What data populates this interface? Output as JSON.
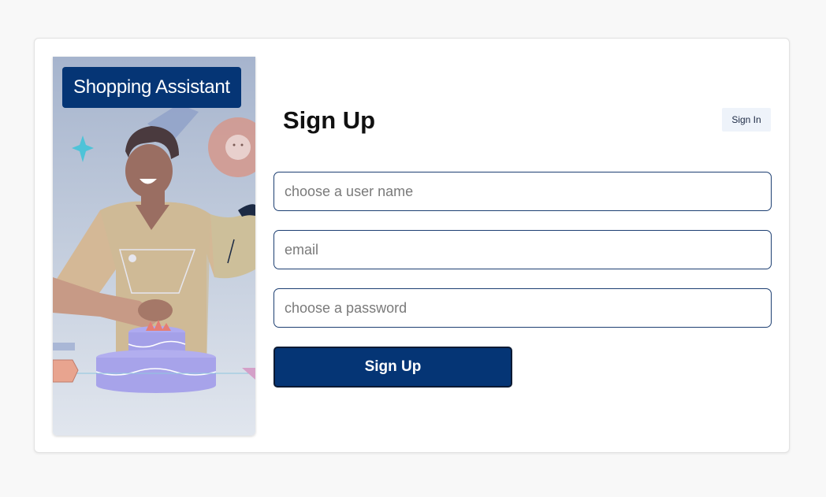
{
  "brand": {
    "name": "Shopping Assistant"
  },
  "form": {
    "title": "Sign Up",
    "signin_label": "Sign In",
    "username_placeholder": "choose a user name",
    "email_placeholder": "email",
    "password_placeholder": "choose a password",
    "submit_label": "Sign Up"
  },
  "colors": {
    "page_background": "#f8f8f8",
    "card_background": "#ffffff",
    "brand_primary": "#053575",
    "signin_background": "#eef3fa",
    "field_border": "#1d3f72"
  },
  "illustration": {
    "subject": "person decorating a cake"
  }
}
